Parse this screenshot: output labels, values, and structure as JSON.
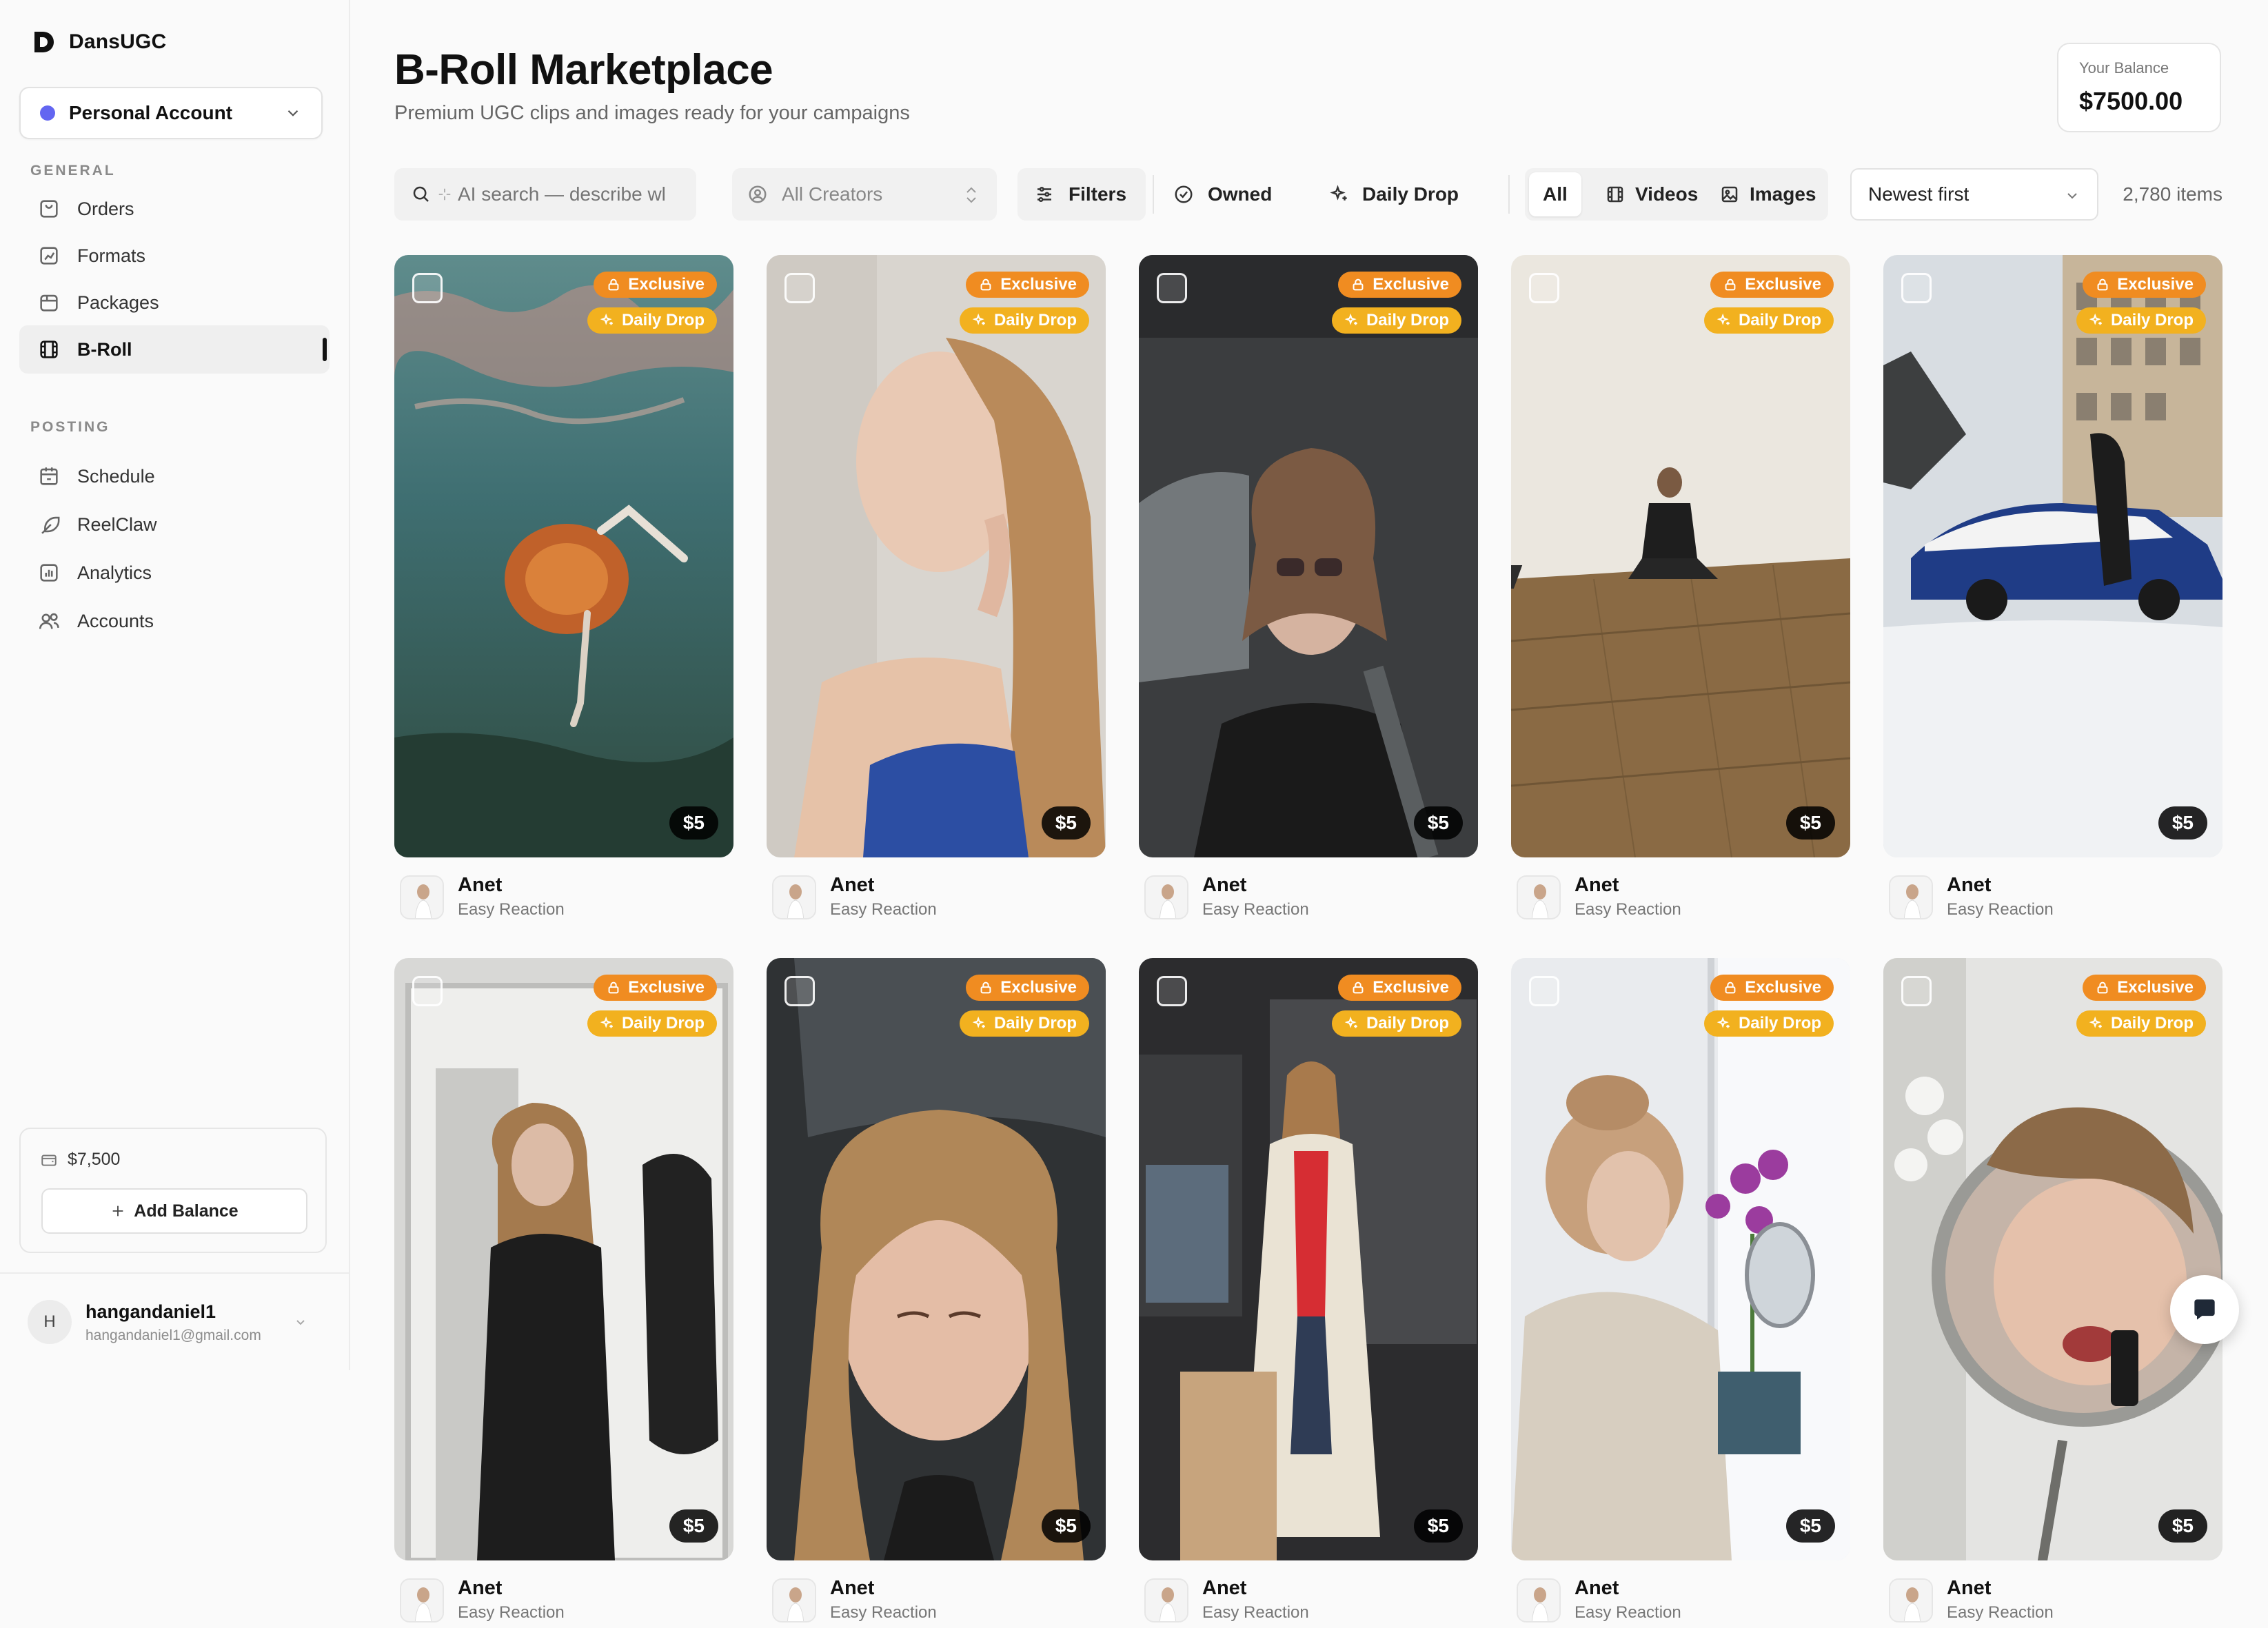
{
  "brand": {
    "name": "DansUGC"
  },
  "account": {
    "label": "Personal Account",
    "color": "#6366f1"
  },
  "sidebar": {
    "general_title": "GENERAL",
    "posting_title": "POSTING",
    "general": [
      {
        "label": "Orders",
        "icon": "shopping-bag-icon"
      },
      {
        "label": "Formats",
        "icon": "chart-icon"
      },
      {
        "label": "Packages",
        "icon": "package-icon"
      },
      {
        "label": "B-Roll",
        "icon": "film-icon",
        "active": true
      }
    ],
    "posting": [
      {
        "label": "Schedule",
        "icon": "calendar-icon"
      },
      {
        "label": "ReelClaw",
        "icon": "feather-icon"
      },
      {
        "label": "Analytics",
        "icon": "bar-chart-icon"
      },
      {
        "label": "Accounts",
        "icon": "users-icon"
      }
    ],
    "balance_amount": "$7,500",
    "add_balance_label": "Add Balance"
  },
  "user": {
    "initial": "H",
    "name": "hangandaniel1",
    "email": "hangandaniel1@gmail.com"
  },
  "header": {
    "title": "B-Roll Marketplace",
    "subtitle": "Premium UGC clips and images ready for your campaigns",
    "balance_label": "Your Balance",
    "balance_value": "$7500.00"
  },
  "toolbar": {
    "search_placeholder": "AI search — describe wl",
    "creators_label": "All Creators",
    "filters_label": "Filters",
    "owned_label": "Owned",
    "daily_drop_label": "Daily Drop",
    "type_all": "All",
    "type_videos": "Videos",
    "type_images": "Images",
    "sort_label": "Newest first",
    "count": "2,780 items"
  },
  "card_labels": {
    "exclusive": "Exclusive",
    "daily_drop": "Daily Drop"
  },
  "cards": [
    {
      "creator": "Anet",
      "format": "Easy Reaction",
      "price": "$5",
      "scene": "underwater"
    },
    {
      "creator": "Anet",
      "format": "Easy Reaction",
      "price": "$5",
      "scene": "earring"
    },
    {
      "creator": "Anet",
      "format": "Easy Reaction",
      "price": "$5",
      "scene": "car-sunglasses"
    },
    {
      "creator": "Anet",
      "format": "Easy Reaction",
      "price": "$5",
      "scene": "room-floor"
    },
    {
      "creator": "Anet",
      "format": "Easy Reaction",
      "price": "$5",
      "scene": "snow-car"
    },
    {
      "creator": "Anet",
      "format": "Easy Reaction",
      "price": "$5",
      "scene": "mirror-room"
    },
    {
      "creator": "Anet",
      "format": "Easy Reaction",
      "price": "$5",
      "scene": "car-face"
    },
    {
      "creator": "Anet",
      "format": "Easy Reaction",
      "price": "$5",
      "scene": "kitchen-coat"
    },
    {
      "creator": "Anet",
      "format": "Easy Reaction",
      "price": "$5",
      "scene": "window-orchid"
    },
    {
      "creator": "Anet",
      "format": "Easy Reaction",
      "price": "$5",
      "scene": "makeup-mirror"
    }
  ],
  "colors": {
    "exclusive": "#f08c21",
    "daily_drop": "#f2b11f",
    "accent": "#111111"
  }
}
